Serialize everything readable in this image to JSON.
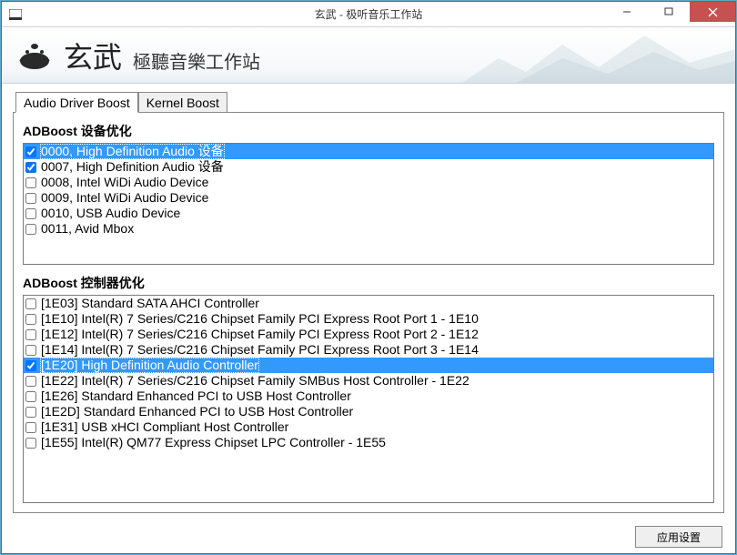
{
  "window": {
    "title": "玄武 - 极听音乐工作站"
  },
  "banner": {
    "name": "玄武",
    "subtitle": "極聽音樂工作站"
  },
  "tabs": [
    {
      "label": "Audio Driver Boost",
      "active": true
    },
    {
      "label": "Kernel Boost",
      "active": false
    }
  ],
  "sections": {
    "devices": {
      "label": "ADBoost 设备优化",
      "items": [
        {
          "checked": true,
          "selected": true,
          "text": "0000, High Definition Audio 设备"
        },
        {
          "checked": true,
          "selected": false,
          "text": "0007, High Definition Audio 设备"
        },
        {
          "checked": false,
          "selected": false,
          "text": "0008, Intel WiDi Audio Device"
        },
        {
          "checked": false,
          "selected": false,
          "text": "0009, Intel WiDi Audio Device"
        },
        {
          "checked": false,
          "selected": false,
          "text": "0010, USB Audio Device"
        },
        {
          "checked": false,
          "selected": false,
          "text": "0011, Avid Mbox"
        }
      ]
    },
    "controllers": {
      "label": "ADBoost 控制器优化",
      "items": [
        {
          "checked": false,
          "selected": false,
          "text": "[1E03] Standard SATA AHCI Controller"
        },
        {
          "checked": false,
          "selected": false,
          "text": "[1E10] Intel(R) 7 Series/C216 Chipset Family PCI Express Root Port 1 - 1E10"
        },
        {
          "checked": false,
          "selected": false,
          "text": "[1E12] Intel(R) 7 Series/C216 Chipset Family PCI Express Root Port 2 - 1E12"
        },
        {
          "checked": false,
          "selected": false,
          "text": "[1E14] Intel(R) 7 Series/C216 Chipset Family PCI Express Root Port 3 - 1E14"
        },
        {
          "checked": true,
          "selected": true,
          "text": "[1E20] High Definition Audio Controller"
        },
        {
          "checked": false,
          "selected": false,
          "text": "[1E22] Intel(R) 7 Series/C216 Chipset Family SMBus Host Controller - 1E22"
        },
        {
          "checked": false,
          "selected": false,
          "text": "[1E26] Standard Enhanced PCI to USB Host Controller"
        },
        {
          "checked": false,
          "selected": false,
          "text": "[1E2D] Standard Enhanced PCI to USB Host Controller"
        },
        {
          "checked": false,
          "selected": false,
          "text": "[1E31] USB xHCI Compliant Host Controller"
        },
        {
          "checked": false,
          "selected": false,
          "text": "[1E55] Intel(R) QM77 Express Chipset LPC Controller - 1E55"
        }
      ]
    }
  },
  "footer": {
    "apply_label": "应用设置"
  }
}
